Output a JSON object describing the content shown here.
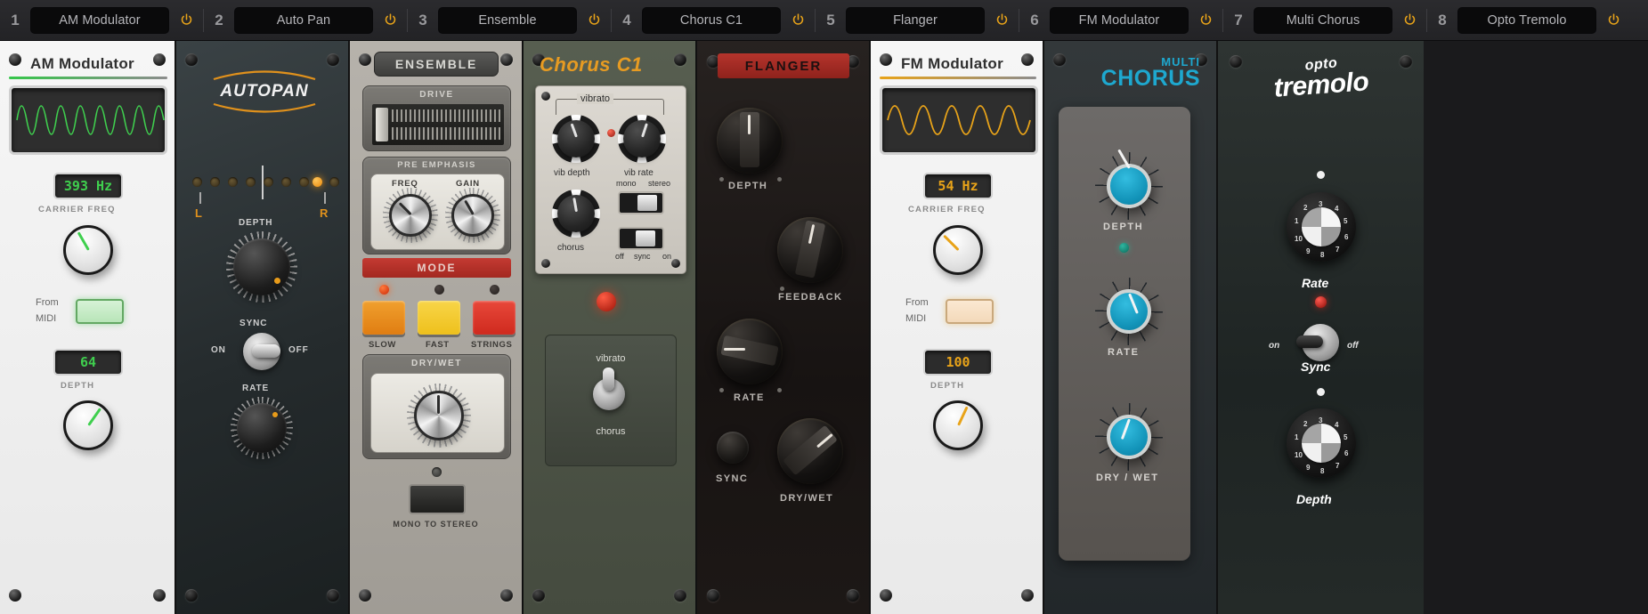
{
  "topbar": {
    "slots": [
      {
        "number": "1",
        "name": "AM Modulator",
        "power_icon": "power-icon"
      },
      {
        "number": "2",
        "name": "Auto Pan",
        "power_icon": "power-icon"
      },
      {
        "number": "3",
        "name": "Ensemble",
        "power_icon": "power-icon"
      },
      {
        "number": "4",
        "name": "Chorus C1",
        "power_icon": "power-icon"
      },
      {
        "number": "5",
        "name": "Flanger",
        "power_icon": "power-icon"
      },
      {
        "number": "6",
        "name": "FM Modulator",
        "power_icon": "power-icon"
      },
      {
        "number": "7",
        "name": "Multi Chorus",
        "power_icon": "power-icon"
      },
      {
        "number": "8",
        "name": "Opto Tremolo",
        "power_icon": "power-icon"
      }
    ]
  },
  "colors": {
    "accent_amber": "#e8a319",
    "accent_green": "#35c64a",
    "accent_cyan": "#1ea8cf",
    "accent_red": "#b5342c",
    "accent_orange": "#e79b22"
  },
  "panels": {
    "am_modulator": {
      "title": "AM Modulator",
      "scope_wave": "sine-waveform",
      "carrier_value": "393 Hz",
      "carrier_label": "CARRIER FREQ",
      "midi_label_1": "From",
      "midi_label_2": "MIDI",
      "depth_value": "64",
      "depth_label": "DEPTH"
    },
    "auto_pan": {
      "title": "AUTOPAN",
      "pan_left": "L",
      "pan_right": "R",
      "depth_label": "DEPTH",
      "sync_label": "SYNC",
      "sync_on": "ON",
      "sync_off": "OFF",
      "rate_label": "RATE",
      "led_count": 9,
      "led_active_index": 8
    },
    "ensemble": {
      "title": "ENSEMBLE",
      "drive_label": "DRIVE",
      "pre_emphasis_label": "PRE EMPHASIS",
      "freq_label": "FREQ",
      "gain_label": "GAIN",
      "mode_label": "MODE",
      "mode_buttons": [
        {
          "label": "SLOW",
          "color": "#ef8f1e",
          "led_on": true
        },
        {
          "label": "FAST",
          "color": "#f5c829",
          "led_on": false
        },
        {
          "label": "STRINGS",
          "color": "#e1392c",
          "led_on": false
        }
      ],
      "drywet_label": "DRY/WET",
      "mono_to_stereo_label": "MONO TO STEREO"
    },
    "chorus_c1": {
      "title": "Chorus C1",
      "vibrato_label": "vibrato",
      "vib_depth_label": "vib depth",
      "vib_rate_label": "vib rate",
      "chorus_label": "chorus",
      "mono_label": "mono",
      "stereo_label": "stereo",
      "off_label": "off",
      "sync_label": "sync",
      "on_label": "on",
      "mode_vibrato": "vibrato",
      "mode_chorus": "chorus"
    },
    "flanger": {
      "title": "FLANGER",
      "depth_label": "DEPTH",
      "feedback_label": "FEEDBACK",
      "rate_label": "RATE",
      "sync_label": "SYNC",
      "drywet_label": "DRY/WET"
    },
    "fm_modulator": {
      "title": "FM Modulator",
      "scope_wave": "sine-waveform",
      "carrier_value": "54 Hz",
      "carrier_label": "CARRIER FREQ",
      "midi_label_1": "From",
      "midi_label_2": "MIDI",
      "depth_value": "100",
      "depth_label": "DEPTH"
    },
    "multi_chorus": {
      "title_top": "MULTI",
      "title_main": "CHORUS",
      "depth_label": "DEPTH",
      "rate_label": "RATE",
      "drywet_label": "DRY / WET"
    },
    "opto_tremolo": {
      "title_top": "opto",
      "title_main": "tremolo",
      "rate_label": "Rate",
      "sync_label": "Sync",
      "sync_on": "on",
      "sync_off": "off",
      "depth_label": "Depth",
      "dial_numbers": [
        "1",
        "2",
        "3",
        "4",
        "5",
        "6",
        "7",
        "8",
        "9",
        "10"
      ]
    }
  }
}
